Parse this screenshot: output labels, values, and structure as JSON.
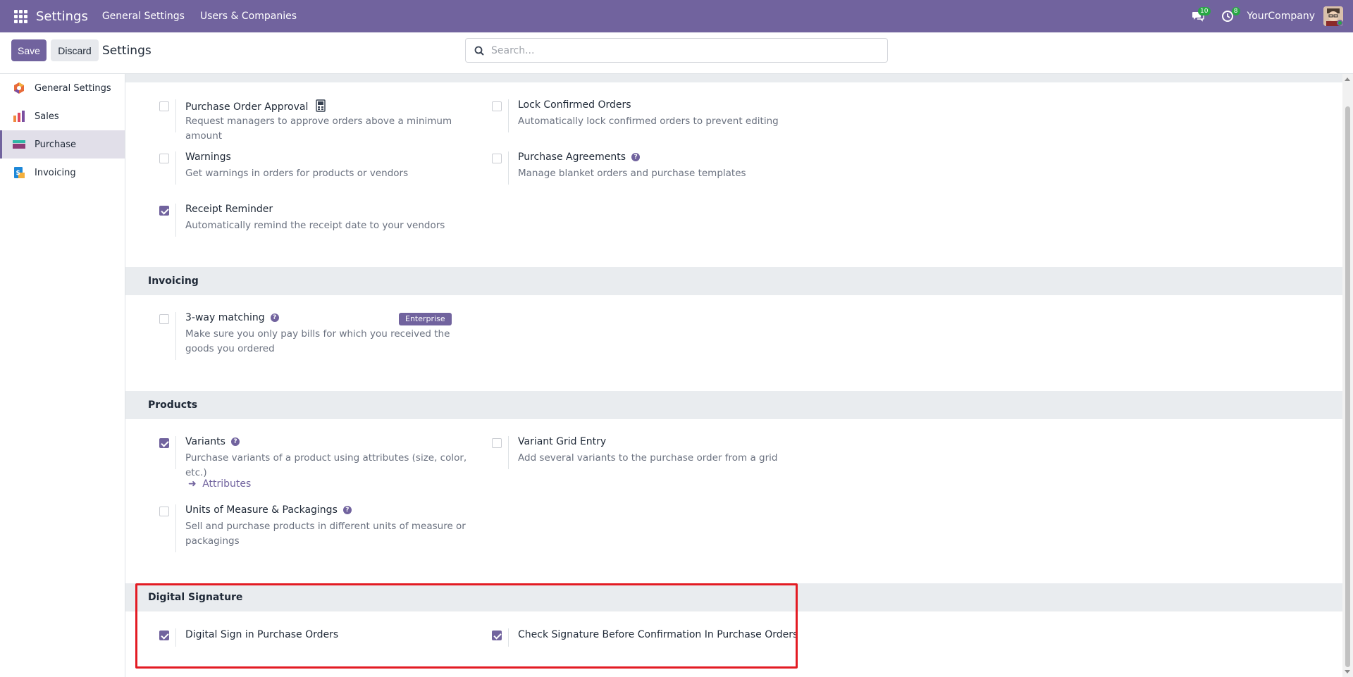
{
  "navbar": {
    "app_title": "Settings",
    "menu": [
      "General Settings",
      "Users & Companies"
    ],
    "messages_count": "10",
    "activities_count": "8",
    "company": "YourCompany"
  },
  "control": {
    "save_label": "Save",
    "discard_label": "Discard",
    "breadcrumb": "Settings",
    "search_placeholder": "Search..."
  },
  "sidebar": {
    "items": [
      {
        "label": "General Settings",
        "icon": "general-settings-icon"
      },
      {
        "label": "Sales",
        "icon": "sales-icon"
      },
      {
        "label": "Purchase",
        "icon": "purchase-icon",
        "active": true
      },
      {
        "label": "Invoicing",
        "icon": "invoicing-icon"
      }
    ]
  },
  "orders": {
    "po_approval": {
      "title": "Purchase Order Approval",
      "desc": "Request managers to approve orders above a minimum amount",
      "checked": false
    },
    "lock_orders": {
      "title": "Lock Confirmed Orders",
      "desc": "Automatically lock confirmed orders to prevent editing",
      "checked": false
    },
    "warnings": {
      "title": "Warnings",
      "desc": "Get warnings in orders for products or vendors",
      "checked": false
    },
    "agreements": {
      "title": "Purchase Agreements",
      "desc": "Manage blanket orders and purchase templates",
      "checked": false
    },
    "receipt_reminder": {
      "title": "Receipt Reminder",
      "desc": "Automatically remind the receipt date to your vendors",
      "checked": true
    }
  },
  "invoicing": {
    "heading": "Invoicing",
    "three_way": {
      "title": "3-way matching",
      "desc": "Make sure you only pay bills for which you received the goods you ordered",
      "badge": "Enterprise",
      "checked": false
    }
  },
  "products": {
    "heading": "Products",
    "variants": {
      "title": "Variants",
      "desc": "Purchase variants of a product using attributes (size, color, etc.)",
      "link": "Attributes",
      "checked": true
    },
    "grid_entry": {
      "title": "Variant Grid Entry",
      "desc": "Add several variants to the purchase order from a grid",
      "checked": false
    },
    "uom": {
      "title": "Units of Measure & Packagings",
      "desc": "Sell and purchase products in different units of measure or packagings",
      "checked": false
    }
  },
  "digital_signature": {
    "heading": "Digital Signature",
    "sign_po": {
      "title": "Digital Sign in Purchase Orders",
      "checked": true
    },
    "check_sig": {
      "title": "Check Signature Before Confirmation In Purchase Orders",
      "checked": true
    }
  },
  "colors": {
    "brand": "#71639e",
    "highlight": "#e31b23",
    "badge": "#28a745"
  }
}
